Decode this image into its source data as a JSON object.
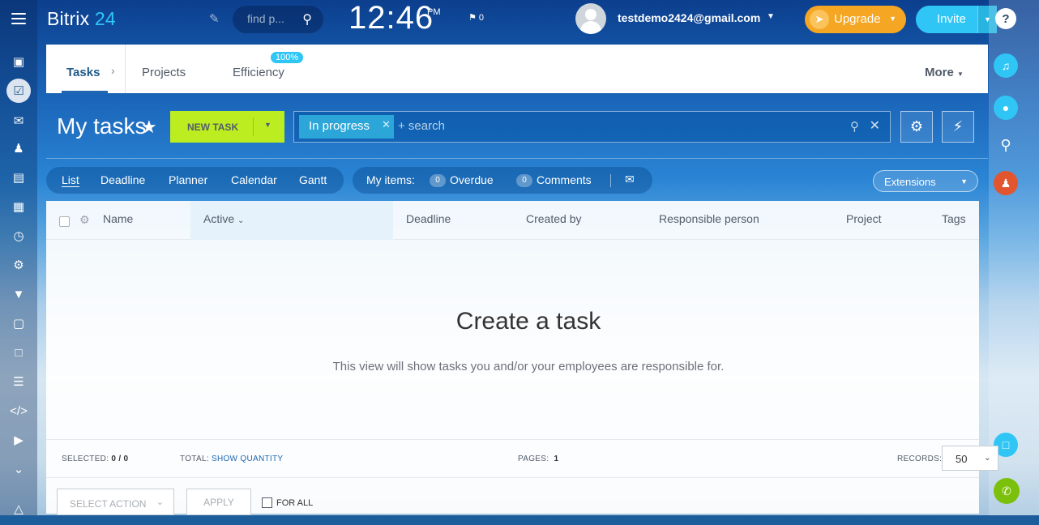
{
  "header": {
    "logo_main": "Bitrix",
    "logo_num": "24",
    "search_placeholder": "find p...",
    "clock": "12:46",
    "ampm": "PM",
    "flag_count": "0",
    "user_email": "testdemo2424@gmail.com",
    "upgrade_label": "Upgrade",
    "invite_label": "Invite",
    "help_label": "?"
  },
  "tabs": {
    "tasks": "Tasks",
    "projects": "Projects",
    "efficiency": "Efficiency",
    "efficiency_badge": "100%",
    "more": "More"
  },
  "toolbar": {
    "title": "My tasks",
    "new_task": "NEW TASK",
    "filter_chip": "In progress",
    "search_placeholder": "+ search"
  },
  "views": [
    "List",
    "Deadline",
    "Planner",
    "Calendar",
    "Gantt"
  ],
  "my_items": {
    "label": "My items:",
    "overdue_count": "0",
    "overdue": "Overdue",
    "comments_count": "0",
    "comments": "Comments"
  },
  "extensions": "Extensions",
  "grid": {
    "columns": [
      "Name",
      "Active",
      "Deadline",
      "Created by",
      "Responsible person",
      "Project",
      "Tags"
    ],
    "empty_title": "Create a task",
    "empty_subtitle": "This view will show tasks you and/or your employees are responsible for."
  },
  "footer": {
    "selected_label": "SELECTED:",
    "selected_value": "0 / 0",
    "total_label": "TOTAL:",
    "total_link": "SHOW QUANTITY",
    "pages_label": "PAGES:",
    "pages_value": "1",
    "records_label": "RECORDS:",
    "records_value": "50",
    "select_action": "SELECT ACTION",
    "apply": "APPLY",
    "for_all": "FOR ALL"
  }
}
